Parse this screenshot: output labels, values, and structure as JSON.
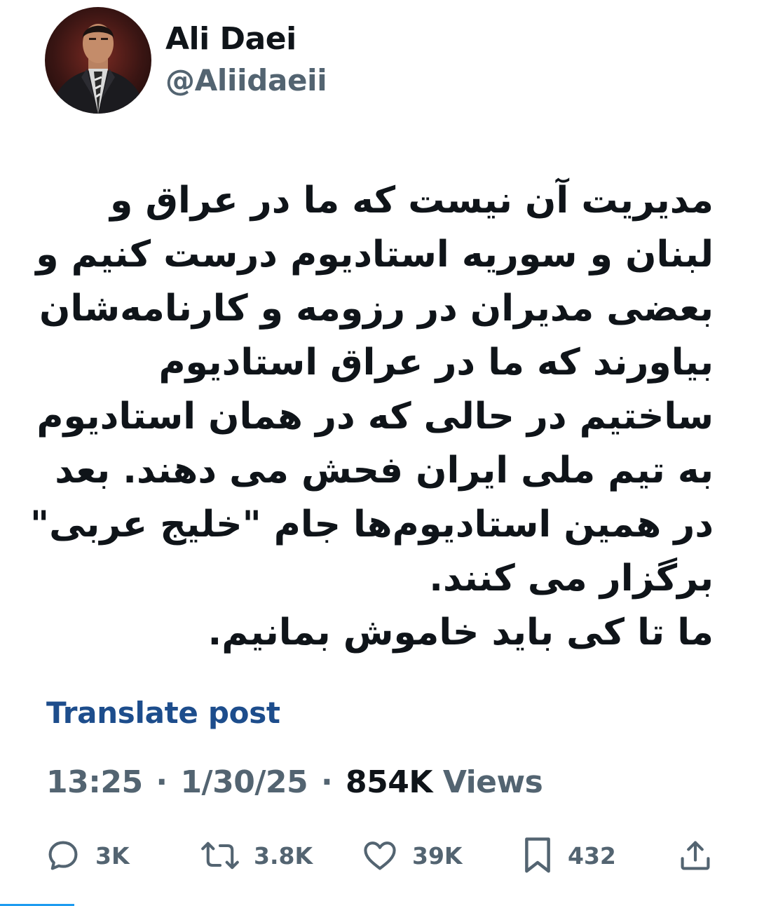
{
  "post": {
    "author": {
      "display_name": "Ali Daei",
      "handle": "@Aliidaeii"
    },
    "text_lines": [
      "مدیریت آن نیست که ما در عراق و",
      "لبنان و سوریه استادیوم درست کنیم و",
      "بعضی مدیران در رزومه و کارنامه‌شان",
      "بیاورند که ما در عراق استادیوم",
      "ساختیم در حالی که در همان استادیوم",
      "به تیم ملی ایران فحش می دهند. بعد",
      "در همین استادیوم‌ها جام \"خلیج عربی\"",
      "برگزار می کنند.",
      "ما تا کی باید خاموش بمانیم."
    ],
    "translate_label": "Translate post",
    "time": "13:25",
    "separator": "·",
    "date": "1/30/25",
    "views_count": "854K",
    "views_label": "Views"
  },
  "actions": {
    "replies": {
      "count": "3K",
      "icon": "reply-icon"
    },
    "reposts": {
      "count": "3.8K",
      "icon": "repost-icon"
    },
    "likes": {
      "count": "39K",
      "icon": "heart-icon"
    },
    "bookmarks": {
      "count": "432",
      "icon": "bookmark-icon"
    },
    "share": {
      "icon": "share-icon"
    }
  },
  "colors": {
    "text": "#0f1419",
    "secondary": "#536471",
    "link": "#1d4d8c",
    "accent": "#1d9bf0"
  }
}
